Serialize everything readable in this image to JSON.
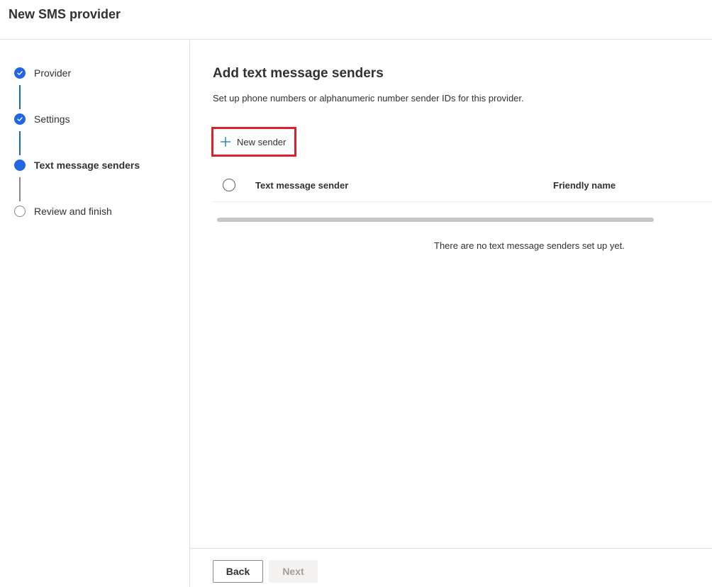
{
  "header": {
    "title": "New SMS provider"
  },
  "steps": [
    {
      "label": "Provider",
      "state": "done"
    },
    {
      "label": "Settings",
      "state": "done"
    },
    {
      "label": "Text message senders",
      "state": "current"
    },
    {
      "label": "Review and finish",
      "state": "todo"
    }
  ],
  "main": {
    "heading": "Add text message senders",
    "description": "Set up phone numbers or alphanumeric number sender IDs for this provider.",
    "new_sender_label": "New sender",
    "table": {
      "columns": [
        "Text message sender",
        "Friendly name"
      ],
      "empty_message": "There are no text message senders set up yet."
    }
  },
  "footer": {
    "back_label": "Back",
    "next_label": "Next"
  },
  "colors": {
    "accent": "#2266e3",
    "highlight_border": "#d9222a",
    "connector_done": "#0f6cbd"
  },
  "icons": {
    "done": "check-icon",
    "add": "plus-icon"
  }
}
